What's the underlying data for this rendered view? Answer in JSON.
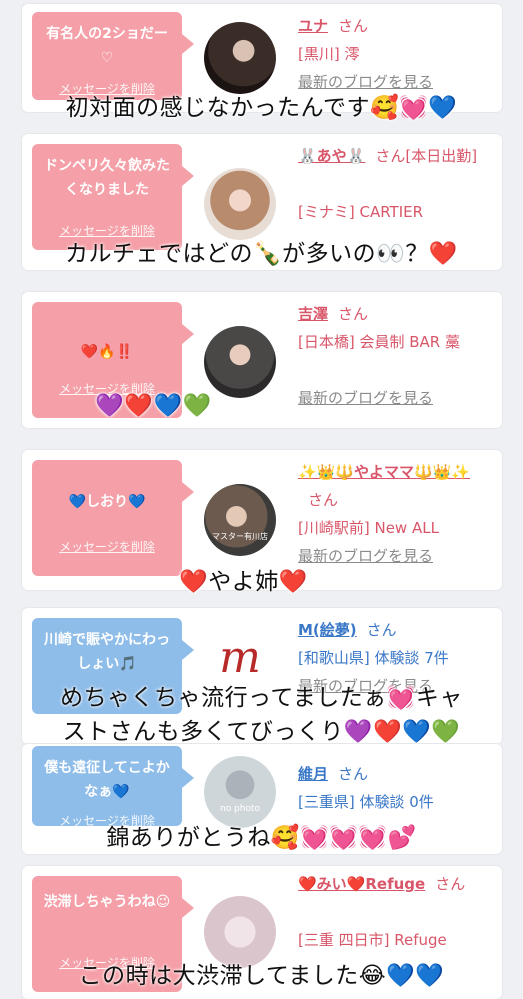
{
  "colors": {
    "pink_bubble": "#f5a0a8",
    "blue_bubble": "#8fbde9",
    "name_pink": "#d95669",
    "name_blue": "#3a78c7"
  },
  "cards": [
    {
      "message": "有名人の2ショだー♡",
      "delete": "メッセージを削除",
      "name": "ユナ",
      "san": "さん",
      "place": "[黒川] 澪",
      "blog": "最新のブログを見る"
    },
    {
      "message": "ドンペリ久々飲みたくなりました",
      "delete": "メッセージを削除",
      "name": "🐰あや🐰",
      "san": "さん[本日出勤]",
      "place": "[ミナミ] CARTIER",
      "blog": ""
    },
    {
      "message": "❤️🔥‼️",
      "delete": "メッセージを削除",
      "name": "吉澤",
      "san": "さん",
      "place": "[日本橋] 会員制 BAR 藁",
      "blog": "最新のブログを見る"
    },
    {
      "message": "💙しおり💙",
      "delete": "メッセージを削除",
      "name": "✨👑🔱やよママ🔱👑✨",
      "san": "さん",
      "place": "[川崎駅前] New ALL",
      "blog": "最新のブログを見る",
      "avatar_text": "マスター有川店"
    },
    {
      "message": "川崎で賑やかにわっしょい🎵",
      "delete": "メッセージを削除",
      "name": "M(絵夢)",
      "san": "さん",
      "place": "[和歌山県] 体験談 7件",
      "blog": "最新のブログを見る",
      "avatar_text": "m"
    },
    {
      "message": "僕も遠征してこよかなぁ💙",
      "delete": "メッセージを削除",
      "name": "維月",
      "san": "さん",
      "place": "[三重県] 体験談 0件",
      "blog": "",
      "avatar_text": "no photo"
    },
    {
      "message": "渋滞しちゃうわね😉",
      "delete": "メッセージを削除",
      "name": "❤️みい❤️Refuge",
      "san": "さん",
      "place": "[三重 四日市] Refuge",
      "blog": ""
    }
  ],
  "overlays": [
    "初対面の感じなかったんです🥰💓💙",
    "カルチェではどの🍾が多いの👀？❤️",
    "💜❤️💙💚",
    "❤️やよ姉❤️",
    "めちゃくちゃ流行ってましたぁ💓キャ",
    "ストさんも多くてびっくり💜❤️💙💚",
    "錦ありがとうね🥰💓💓💓💕",
    "この時は大渋滞してました😂💙💙"
  ]
}
